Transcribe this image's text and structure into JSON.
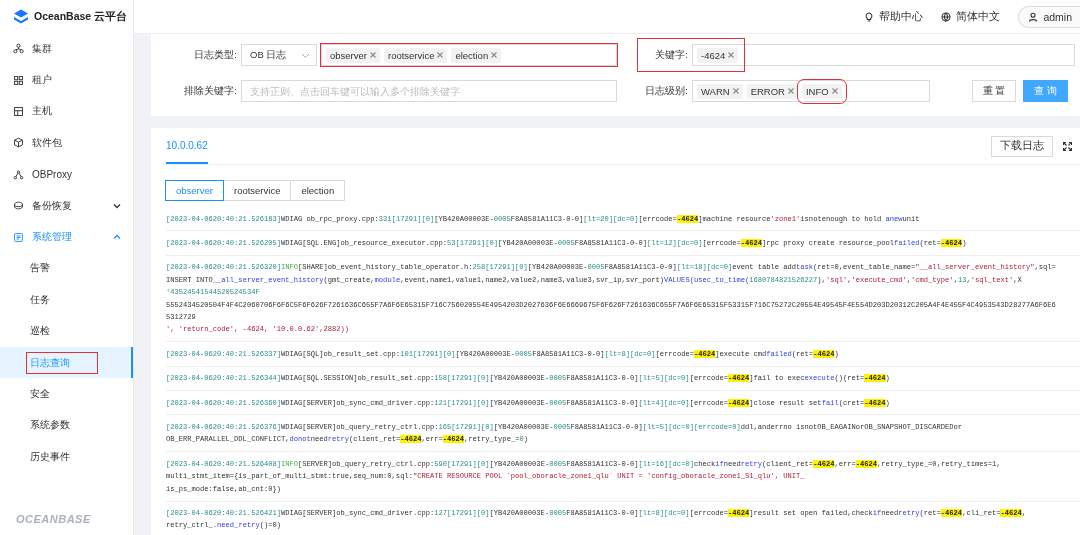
{
  "brand": {
    "name": "OceanBase 云平台"
  },
  "topbar": {
    "help": "帮助中心",
    "language": "简体中文",
    "user": "admin"
  },
  "sidebar": {
    "items": [
      {
        "label": "集群",
        "selected": false
      },
      {
        "label": "租户",
        "selected": false
      },
      {
        "label": "主机",
        "selected": false
      },
      {
        "label": "软件包",
        "selected": false
      },
      {
        "label": "OBProxy",
        "selected": false
      },
      {
        "label": "备份恢复",
        "selected": false,
        "expanded": false
      },
      {
        "label": "系统管理",
        "selected": true,
        "expanded": true,
        "children": [
          {
            "label": "告警",
            "selected": false,
            "annotated": false
          },
          {
            "label": "任务",
            "selected": false,
            "annotated": false
          },
          {
            "label": "巡检",
            "selected": false,
            "annotated": false
          },
          {
            "label": "日志查询",
            "selected": true,
            "annotated": true
          },
          {
            "label": "安全",
            "selected": false,
            "annotated": false
          },
          {
            "label": "系统参数",
            "selected": false,
            "annotated": false
          },
          {
            "label": "历史事件",
            "selected": false,
            "annotated": false
          }
        ]
      }
    ],
    "footer_logo": "OCEANBASE"
  },
  "filters": {
    "log_type": {
      "label": "日志类型:",
      "value": "OB 日志",
      "annotated": true,
      "tags": [
        {
          "label": "observer"
        },
        {
          "label": "rootservice"
        },
        {
          "label": "election"
        }
      ]
    },
    "keyword": {
      "label": "关键字:",
      "annotated": true,
      "tags": [
        {
          "label": "-4624"
        }
      ]
    },
    "exclude": {
      "label": "排除关键字:",
      "placeholder": "支持正则、点击回车键可以输入多个排除关键字"
    },
    "level": {
      "label": "日志级别:",
      "tags": [
        {
          "label": "WARN",
          "annotated": false
        },
        {
          "label": "ERROR",
          "annotated": false
        },
        {
          "label": "INFO",
          "annotated": true
        }
      ]
    },
    "buttons": [
      {
        "label": "重 置",
        "kind": "default"
      },
      {
        "label": "查 询",
        "kind": "primary"
      }
    ]
  },
  "log_panel": {
    "host_tabs": [
      {
        "label": "10.0.0.62",
        "selected": true
      }
    ],
    "download": "下载日志",
    "file_tabs": [
      {
        "label": "observer",
        "selected": true
      },
      {
        "label": "rootservice",
        "selected": false
      },
      {
        "label": "election",
        "selected": false
      }
    ],
    "entries": [
      {
        "lines": [
          [
            {
              "kind": "num",
              "text": "[2023-04-0620:40:21.526183]"
            },
            {
              "kind": "plain",
              "text": "WDIAG ob_rpc_proxy.cpp:"
            },
            {
              "kind": "num",
              "text": "331[17291][0]"
            },
            {
              "kind": "plain",
              "text": "[YB420A00003E-"
            },
            {
              "kind": "num",
              "text": "0005"
            },
            {
              "kind": "plain",
              "text": "F8A8581A11C3-0-0]"
            },
            {
              "kind": "num",
              "text": "[lt=20][dc=0]"
            },
            {
              "kind": "plain",
              "text": "[errcode="
            },
            {
              "kind": "hit",
              "text": "-4624"
            },
            {
              "kind": "plain",
              "text": "]machine resource"
            },
            {
              "kind": "str",
              "text": "'zone1'"
            },
            {
              "kind": "plain",
              "text": "isnotenough to hold "
            },
            {
              "kind": "func",
              "text": "anew"
            },
            {
              "kind": "plain",
              "text": "unit"
            }
          ]
        ]
      },
      {
        "lines": [
          [
            {
              "kind": "num",
              "text": "[2023-04-0620:40:21.526205]"
            },
            {
              "kind": "plain",
              "text": "WDIAG[SQL.ENG]ob_resource_executor.cpp:"
            },
            {
              "kind": "num",
              "text": "53[17291][0]"
            },
            {
              "kind": "plain",
              "text": "[YB420A00003E-"
            },
            {
              "kind": "num",
              "text": "0005"
            },
            {
              "kind": "plain",
              "text": "F8A8581A11C3-0-0]"
            },
            {
              "kind": "num",
              "text": "[lt=12][dc=0]"
            },
            {
              "kind": "plain",
              "text": "[errcode="
            },
            {
              "kind": "hit",
              "text": "-4624"
            },
            {
              "kind": "plain",
              "text": "]rpc proxy create resource_pool"
            },
            {
              "kind": "func",
              "text": "failed"
            },
            {
              "kind": "plain",
              "text": "(ret="
            },
            {
              "kind": "hit",
              "text": "-4624"
            },
            {
              "kind": "plain",
              "text": ")"
            }
          ]
        ]
      },
      {
        "lines": [
          [
            {
              "kind": "num",
              "text": "[2023-04-0620:40:21.526320]"
            },
            {
              "kind": "level",
              "text": "INFO"
            },
            {
              "kind": "plain",
              "text": "[SHARE]ob_event_history_table_operator.h:"
            },
            {
              "kind": "num",
              "text": "258[17291][0]"
            },
            {
              "kind": "plain",
              "text": "[YB420A00003E-"
            },
            {
              "kind": "num",
              "text": "0005"
            },
            {
              "kind": "plain",
              "text": "F8A8581A11C3-0-0]"
            },
            {
              "kind": "num",
              "text": "[lt=18][dc=0]"
            },
            {
              "kind": "plain",
              "text": "event table add"
            },
            {
              "kind": "func",
              "text": "task"
            },
            {
              "kind": "plain",
              "text": "(ret=0,event_table_name="
            },
            {
              "kind": "str",
              "text": "\"__all_server_event_history\""
            },
            {
              "kind": "plain",
              "text": ",sql="
            }
          ],
          [
            {
              "kind": "plain",
              "text": "INSERT INTO"
            },
            {
              "kind": "func",
              "text": "__all_server_event_history"
            },
            {
              "kind": "plain",
              "text": "(gmt_create,"
            },
            {
              "kind": "func",
              "text": "module"
            },
            {
              "kind": "plain",
              "text": ",event,name1,value1,name2,value2,name3,value3,svr_ip,svr_port)"
            },
            {
              "kind": "func",
              "text": "VALUES(usec_to_time("
            },
            {
              "kind": "num",
              "text": "1680784821526227"
            },
            {
              "kind": "plain",
              "text": "),"
            },
            {
              "kind": "str",
              "text": "'sql'"
            },
            {
              "kind": "plain",
              "text": ","
            },
            {
              "kind": "str",
              "text": "'execute_cmd'"
            },
            {
              "kind": "plain",
              "text": ","
            },
            {
              "kind": "str",
              "text": "'cmd_type'"
            },
            {
              "kind": "plain",
              "text": ","
            },
            {
              "kind": "num",
              "text": "13"
            },
            {
              "kind": "plain",
              "text": ","
            },
            {
              "kind": "str",
              "text": "'sql_text'"
            },
            {
              "kind": "plain",
              "text": ",X"
            }
          ],
          [
            {
              "kind": "num",
              "text": "'43524541544520524534F"
            }
          ],
          [
            {
              "kind": "plain",
              "text": "5552434520504F4F4C2060706F6F6C5F6F626F7261636C655F7A6F6E65315F716C756020554E4954203D2027636F6E6669675F6F626F7261636C655F7A6F6E65315F53315F716C75272C20554E49545F4E554D203D20312C205A4F4E455F4C4953543D28277A6F6E6"
            }
          ],
          [
            {
              "kind": "plain",
              "text": "5312729"
            }
          ],
          [
            {
              "kind": "str",
              "text": "', 'return_code', -4624, '10.0.0.62',2882))"
            }
          ]
        ]
      },
      {
        "lines": [
          [
            {
              "kind": "num",
              "text": "[2023-04-0620:40:21.526337]"
            },
            {
              "kind": "plain",
              "text": "WDIAG[SQL]ob_result_set.cpp:"
            },
            {
              "kind": "num",
              "text": "101[17291][0]"
            },
            {
              "kind": "plain",
              "text": "[YB420A00003E-"
            },
            {
              "kind": "num",
              "text": "0005"
            },
            {
              "kind": "plain",
              "text": "F8A8581A11C3-0-0]"
            },
            {
              "kind": "num",
              "text": "[lt=8][dc=0]"
            },
            {
              "kind": "plain",
              "text": "[errcode="
            },
            {
              "kind": "hit",
              "text": "-4624"
            },
            {
              "kind": "plain",
              "text": "]execute cmd"
            },
            {
              "kind": "func",
              "text": "failed"
            },
            {
              "kind": "plain",
              "text": "(ret="
            },
            {
              "kind": "hit",
              "text": "-4624"
            },
            {
              "kind": "plain",
              "text": ")"
            }
          ]
        ]
      },
      {
        "lines": [
          [
            {
              "kind": "num",
              "text": "[2023-04-0620:40:21.526344]"
            },
            {
              "kind": "plain",
              "text": "WDIAG[SQL.SESSION]ob_result_set.cpp:"
            },
            {
              "kind": "num",
              "text": "158[17291][0]"
            },
            {
              "kind": "plain",
              "text": "[YB420A00003E-"
            },
            {
              "kind": "num",
              "text": "0005"
            },
            {
              "kind": "plain",
              "text": "F8A8581A11C3-0-0]"
            },
            {
              "kind": "num",
              "text": "[lt=5][dc=0]"
            },
            {
              "kind": "plain",
              "text": "[errcode="
            },
            {
              "kind": "hit",
              "text": "-4624"
            },
            {
              "kind": "plain",
              "text": "]fail to exec"
            },
            {
              "kind": "func",
              "text": "execute"
            },
            {
              "kind": "plain",
              "text": "()(ret="
            },
            {
              "kind": "hit",
              "text": "-4624"
            },
            {
              "kind": "plain",
              "text": ")"
            }
          ]
        ]
      },
      {
        "lines": [
          [
            {
              "kind": "num",
              "text": "[2023-04-0620:40:21.526360]"
            },
            {
              "kind": "plain",
              "text": "WDIAG[SERVER]ob_sync_cmd_driver.cpp:"
            },
            {
              "kind": "num",
              "text": "121[17291][0]"
            },
            {
              "kind": "plain",
              "text": "[YB420A00003E-"
            },
            {
              "kind": "num",
              "text": "0005"
            },
            {
              "kind": "plain",
              "text": "F8A8581A11C3-0-0]"
            },
            {
              "kind": "num",
              "text": "[lt=4][dc=0]"
            },
            {
              "kind": "plain",
              "text": "[errcode="
            },
            {
              "kind": "hit",
              "text": "-4624"
            },
            {
              "kind": "plain",
              "text": "]close result set"
            },
            {
              "kind": "func",
              "text": "fail"
            },
            {
              "kind": "plain",
              "text": "(cret="
            },
            {
              "kind": "hit",
              "text": "-4624"
            },
            {
              "kind": "plain",
              "text": ")"
            }
          ]
        ]
      },
      {
        "lines": [
          [
            {
              "kind": "num",
              "text": "[2023-04-0620:40:21.526376]"
            },
            {
              "kind": "plain",
              "text": "WDIAG[SERVER]ob_query_retry_ctrl.cpp:"
            },
            {
              "kind": "num",
              "text": "165[17291][0]"
            },
            {
              "kind": "plain",
              "text": "[YB420A00003E-"
            },
            {
              "kind": "num",
              "text": "0005"
            },
            {
              "kind": "plain",
              "text": "F8A8581A11C3-0-0]"
            },
            {
              "kind": "num",
              "text": "[lt=5][dc=0][errcode=0]"
            },
            {
              "kind": "plain",
              "text": "ddl,anderrno isnotOB_EAGAINorOB_SNAPSHOT_DISCARDEDor"
            }
          ],
          [
            {
              "kind": "plain",
              "text": "OB_ERR_PARALLEL_DDL_CONFLICT,"
            },
            {
              "kind": "func",
              "text": "donot"
            },
            {
              "kind": "plain",
              "text": "need"
            },
            {
              "kind": "func",
              "text": "retry"
            },
            {
              "kind": "plain",
              "text": "(client_ret="
            },
            {
              "kind": "hit",
              "text": "-4624"
            },
            {
              "kind": "plain",
              "text": ",err="
            },
            {
              "kind": "hit",
              "text": "-4624"
            },
            {
              "kind": "plain",
              "text": ",retry_type_="
            },
            {
              "kind": "num",
              "text": "0"
            },
            {
              "kind": "plain",
              "text": ")"
            }
          ]
        ]
      },
      {
        "lines": [
          [
            {
              "kind": "num",
              "text": "[2023-04-0620:40:21.526408]"
            },
            {
              "kind": "level",
              "text": "INFO"
            },
            {
              "kind": "plain",
              "text": "[SERVER]ob_query_retry_ctrl.cpp:"
            },
            {
              "kind": "num",
              "text": "590[17291][0]"
            },
            {
              "kind": "plain",
              "text": "[YB420A00003E-"
            },
            {
              "kind": "num",
              "text": "0005"
            },
            {
              "kind": "plain",
              "text": "F8A8581A11C3-0-0]"
            },
            {
              "kind": "num",
              "text": "[lt=16][dc=0]"
            },
            {
              "kind": "plain",
              "text": "check"
            },
            {
              "kind": "func",
              "text": "if"
            },
            {
              "kind": "plain",
              "text": "need"
            },
            {
              "kind": "func",
              "text": "retry"
            },
            {
              "kind": "plain",
              "text": "(client_ret="
            },
            {
              "kind": "hit",
              "text": "-4624"
            },
            {
              "kind": "plain",
              "text": ",err="
            },
            {
              "kind": "hit",
              "text": "-4624"
            },
            {
              "kind": "plain",
              "text": ",retry_type_=0,retry_times=1,"
            }
          ],
          [
            {
              "kind": "plain",
              "text": "multi_stmt_item={is_part_of_multi_stmt:true,seq_num:0,sql:"
            },
            {
              "kind": "str",
              "text": "\"CREATE RESOURCE POOL `pool_oboracle_zone1_qlu` UNIT = 'config_oboracle_zone1_S1_qlu', UNIT_"
            }
          ],
          [
            {
              "kind": "plain",
              "text": "is_ps_mode:false,ab_cnt:0})"
            }
          ]
        ]
      },
      {
        "lines": [
          [
            {
              "kind": "num",
              "text": "[2023-04-0620:40:21.526421]"
            },
            {
              "kind": "plain",
              "text": "WDIAG[SERVER]ob_sync_cmd_driver.cpp:"
            },
            {
              "kind": "num",
              "text": "127[17291][0]"
            },
            {
              "kind": "plain",
              "text": "[YB420A00003E-"
            },
            {
              "kind": "num",
              "text": "0005"
            },
            {
              "kind": "plain",
              "text": "F8A8581A11C3-0-0]"
            },
            {
              "kind": "num",
              "text": "[lt=8][dc=0]"
            },
            {
              "kind": "plain",
              "text": "[errcode="
            },
            {
              "kind": "hit",
              "text": "-4624"
            },
            {
              "kind": "plain",
              "text": "]result set open failed,check"
            },
            {
              "kind": "func",
              "text": "if"
            },
            {
              "kind": "plain",
              "text": "need"
            },
            {
              "kind": "func",
              "text": "retry"
            },
            {
              "kind": "plain",
              "text": "(ret="
            },
            {
              "kind": "hit",
              "text": "-4624"
            },
            {
              "kind": "plain",
              "text": ",cli_ret="
            },
            {
              "kind": "hit",
              "text": "-4624"
            },
            {
              "kind": "plain",
              "text": ","
            }
          ],
          [
            {
              "kind": "plain",
              "text": "retry_ctrl_."
            },
            {
              "kind": "func",
              "text": "need_retry"
            },
            {
              "kind": "plain",
              "text": "()=0)"
            }
          ]
        ]
      }
    ]
  }
}
